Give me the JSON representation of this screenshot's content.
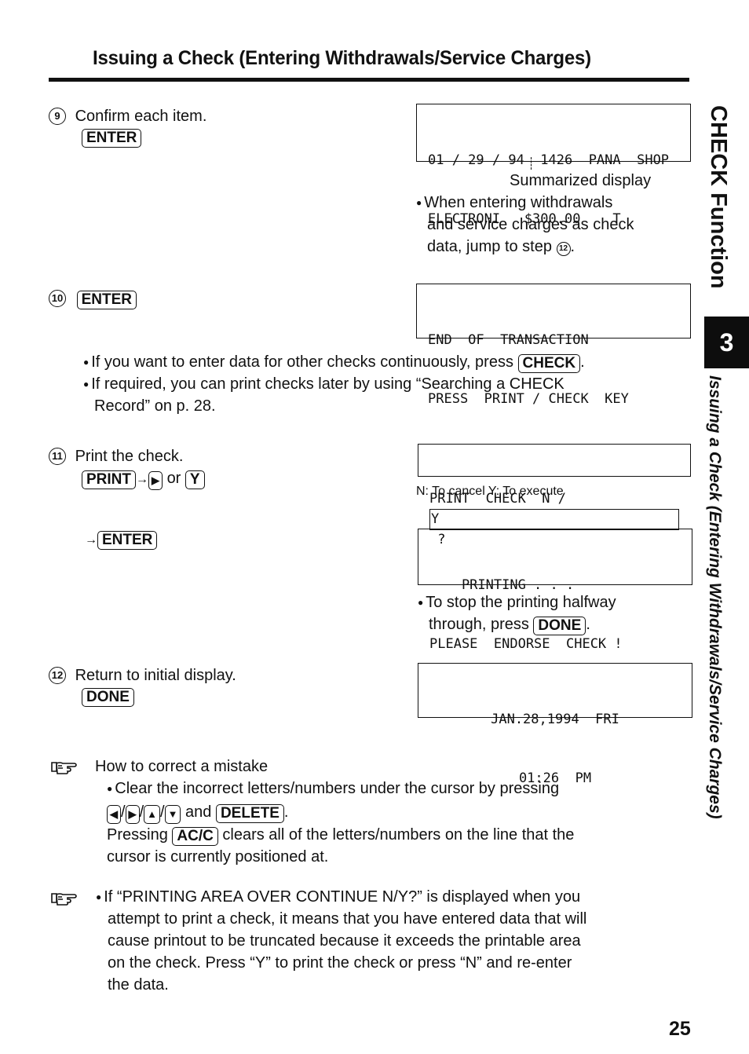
{
  "header": {
    "title": "Issuing a Check (Entering Withdrawals/Service Charges)"
  },
  "side_tab": {
    "section": "CHECK Function",
    "chapter_number": "3",
    "subsection": "Issuing a Check (Entering Withdrawals/Service Charges)"
  },
  "steps": {
    "step9": {
      "number": "9",
      "text": "Confirm each item.",
      "key": "ENTER",
      "display_lines": [
        "01 / 29 / 94  1426  PANA  SHOP",
        "ELECTRONI   $300.00    T"
      ],
      "caption": "Summarized display",
      "note_lines": [
        "When entering withdrawals",
        "and service charges as check",
        "data, jump to step"
      ],
      "note_step_ref": "12",
      "note_end": "."
    },
    "step10": {
      "number": "10",
      "key": "ENTER",
      "display_lines": [
        "END  OF  TRANSACTION",
        "PRESS  PRINT / CHECK  KEY"
      ],
      "notes": [
        {
          "text": "If you want to enter data for other checks continuously, press",
          "key": "CHECK",
          "end": "."
        },
        {
          "text_line1": "If required, you can print checks later by using “Searching a CHECK",
          "text_line2": "Record” on p. 28."
        }
      ]
    },
    "step11": {
      "number": "11",
      "text": "Print the check.",
      "key_print": "PRINT",
      "key_right": "▶",
      "or_label": "or",
      "key_y": "Y",
      "display1_prefix": "PRINT  CHECK  N /",
      "display1_cursor": "Y",
      "display1_suffix": " ?",
      "caption": "N: To cancel   Y: To execute",
      "key_enter": "ENTER",
      "display2_lines": [
        "    PRINTING . . .",
        "PLEASE  ENDORSE  CHECK !"
      ],
      "note_line1": "To stop the printing halfway",
      "note_line2": "through, press",
      "note_key": "DONE",
      "note_end": "."
    },
    "step12": {
      "number": "12",
      "text": "Return to initial display.",
      "key": "DONE",
      "display_lines": [
        "JAN.28,1994  FRI",
        "01:26  PM"
      ]
    }
  },
  "tips": {
    "correct": {
      "heading": "How to correct a mistake",
      "line1": "Clear the incorrect letters/numbers under the cursor by pressing",
      "keys": [
        "◀",
        "▶",
        "▲",
        "▼"
      ],
      "sep": "/",
      "and_label": "and",
      "delete_key": "DELETE",
      "end": ".",
      "pressing_label": "Pressing",
      "acc_key": "AC/C",
      "line3_rest": "clears all of the letters/numbers on the line that the",
      "line4": "cursor is currently positioned at."
    },
    "printing_area": {
      "lines": [
        "If “PRINTING AREA OVER CONTINUE N/Y?” is displayed when you",
        "attempt to print a check, it means that you have entered data that will",
        "cause printout to be truncated because it exceeds the printable area",
        "on the check. Press “Y” to print the check or press “N” and re-enter",
        "the data."
      ]
    }
  },
  "footer": {
    "page_number": "25"
  }
}
